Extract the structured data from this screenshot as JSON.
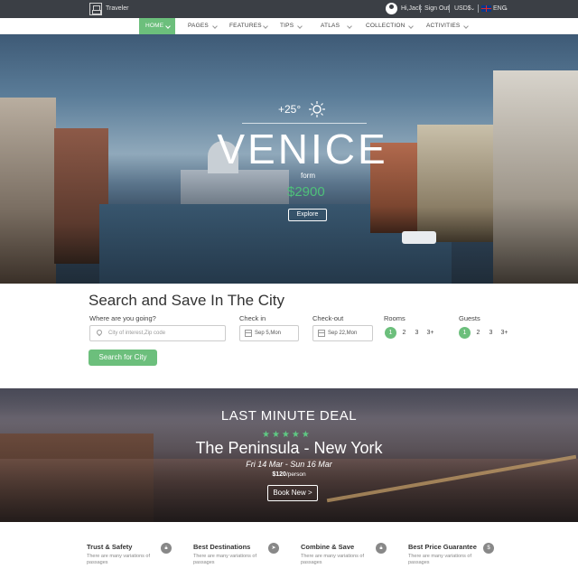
{
  "topbar": {
    "brand": "Traveler",
    "greeting": "Hi,Jack",
    "sign_out": "Sign Out",
    "currency": "USD$",
    "language": "ENG"
  },
  "nav": {
    "items": [
      {
        "label": "HOME",
        "active": true
      },
      {
        "label": "PAGES"
      },
      {
        "label": "FEATURES"
      },
      {
        "label": "TIPS"
      },
      {
        "label": "ATLAS"
      },
      {
        "label": "COLLECTION"
      },
      {
        "label": "ACTIVITIES"
      }
    ]
  },
  "hero": {
    "temperature": "+25°",
    "city": "VENICE",
    "from_label": "form",
    "price": "$2900",
    "explore_label": "Explore"
  },
  "search": {
    "title": "Search and Save In The City",
    "where_label": "Where are you going?",
    "where_placeholder": "City of interest,Zip code",
    "checkin_label": "Check in",
    "checkin_value": "Sep 5,Mon",
    "checkout_label": "Check-out",
    "checkout_value": "Sep 22,Mon",
    "rooms_label": "Rooms",
    "rooms_options": [
      "1",
      "2",
      "3",
      "3+"
    ],
    "guests_label": "Guests",
    "guests_options": [
      "1",
      "2",
      "3",
      "3+"
    ],
    "button_label": "Search for City"
  },
  "deal": {
    "heading": "LAST MINUTE DEAL",
    "stars": "★★★★★",
    "hotel": "The Peninsula - New York",
    "dates": "Fri 14 Mar - Sun 16 Mar",
    "price": "$120",
    "per": "/person",
    "button_label": "Book New >"
  },
  "features": [
    {
      "title": "Trust & Safety",
      "desc": "There are many variations of passages",
      "icon": "lock-icon"
    },
    {
      "title": "Best Destinations",
      "desc": "There are many variations of passages",
      "icon": "send-icon"
    },
    {
      "title": "Combine & Save",
      "desc": "There are many variations of passages",
      "icon": "lock-icon"
    },
    {
      "title": "Best Price Guarantee",
      "desc": "There are many variations of passages",
      "icon": "dollar-icon"
    }
  ],
  "colors": {
    "accent": "#6cbf7c",
    "topbar": "#3b3f45",
    "price_green": "#4fc07a"
  }
}
